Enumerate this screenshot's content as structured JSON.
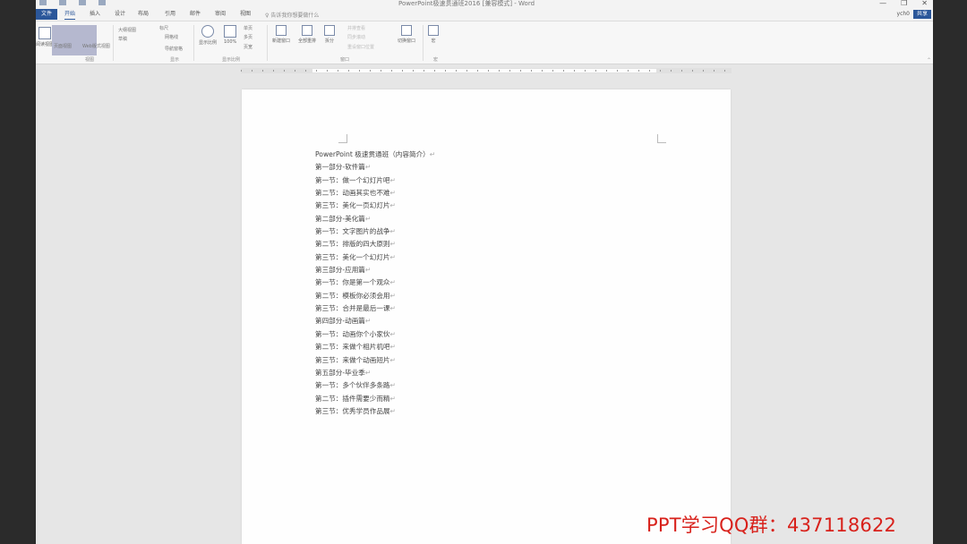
{
  "window": {
    "title": "PowerPoint极速贯通班2016 [兼容模式] - Word",
    "controls": [
      "—",
      "❐",
      "✕"
    ]
  },
  "quick_access": [
    "save-icon",
    "undo-icon",
    "redo-icon",
    "customize-icon"
  ],
  "tabs": {
    "file": "文件",
    "items": [
      "开始",
      "插入",
      "设计",
      "布局",
      "引用",
      "邮件",
      "审阅",
      "视图"
    ],
    "active": "开始",
    "tell_me": "告诉我你想要做什么",
    "user": "ych0",
    "share": "共享"
  },
  "ribbon": {
    "views": [
      "阅读视图",
      "页面视图",
      "Web版式视图"
    ],
    "show": [
      "大纲视图",
      "草稿",
      "标尺",
      "网格线",
      "导航窗格"
    ],
    "zoom": [
      "显示比例",
      "100%",
      "单页",
      "多页",
      "页宽"
    ],
    "window": [
      "新建窗口",
      "全部重排",
      "拆分",
      "并排查看",
      "同步滚动",
      "重设窗口位置",
      "切换窗口"
    ],
    "macros": "宏",
    "groups": [
      "视图",
      "显示",
      "显示比例",
      "窗口",
      "宏"
    ]
  },
  "document": {
    "lines": [
      "PowerPoint 极速贯通班（内容简介）",
      "第一部分-软件篇",
      "第一节：做一个幻灯片吧",
      "第二节：动画其实也不难",
      "第三节：美化一页幻灯片",
      "第二部分-美化篇",
      "第一节：文字图片的战争",
      "第二节：排版的四大原则",
      "第三节：美化一个幻灯片",
      "第三部分-应用篇",
      "第一节：你是第一个观众",
      "第二节：模板你必须会用",
      "第三节：合并是最后一课",
      "第四部分-动画篇",
      "第一节：动画你个小家伙",
      "第二节：来做个相片机吧",
      "第三节：来做个动画短片",
      "第五部分-毕业季",
      "第一节：多个伙伴多条路",
      "第二节：插件需要少而精",
      "第三节：优秀学员作品展"
    ],
    "paragraph_mark": "↵"
  },
  "watermark": "PPT学习QQ群：437118622",
  "colors": {
    "accent": "#2b579a",
    "watermark": "#d8211b"
  }
}
